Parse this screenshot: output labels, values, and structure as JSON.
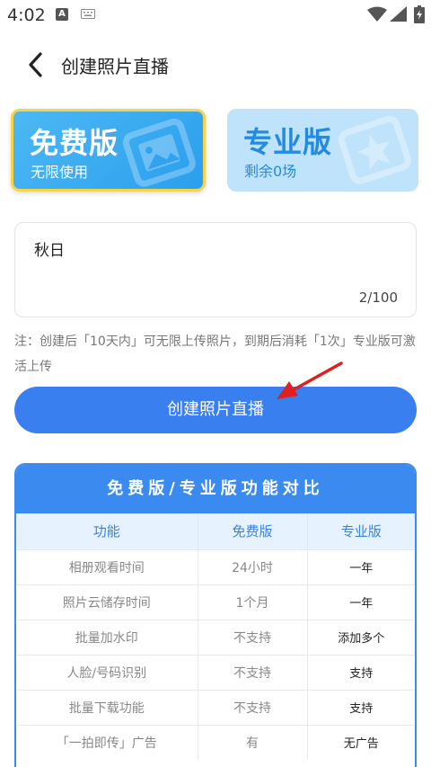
{
  "status_bar": {
    "time": "4:02",
    "notification_badge": "A"
  },
  "header": {
    "title": "创建照片直播"
  },
  "plans": {
    "free": {
      "name": "免费版",
      "subtitle": "无限使用"
    },
    "pro": {
      "name": "专业版",
      "subtitle": "剩余0场"
    }
  },
  "name_input": {
    "value": "秋日",
    "counter": "2/100"
  },
  "note": "注：创建后「10天内」可无限上传照片，到期后消耗「1次」专业版可激活上传",
  "create_button": "创建照片直播",
  "comparison": {
    "title": "免费版/专业版功能对比",
    "headers": [
      "功能",
      "免费版",
      "专业版"
    ],
    "rows": [
      [
        "相册观看时间",
        "24小时",
        "一年"
      ],
      [
        "照片云储存时间",
        "1个月",
        "一年"
      ],
      [
        "批量加水印",
        "不支持",
        "添加多个"
      ],
      [
        "人脸/号码识别",
        "不支持",
        "支持"
      ],
      [
        "批量下载功能",
        "不支持",
        "支持"
      ],
      [
        "「一拍即传」广告",
        "有",
        "无广告"
      ]
    ]
  },
  "colors": {
    "accent": "#3a7ff0",
    "free_card": "#2b9fee",
    "pro_card": "#bfe3fb",
    "highlight_border": "#f5d34a",
    "annotation_arrow": "#e02020"
  }
}
